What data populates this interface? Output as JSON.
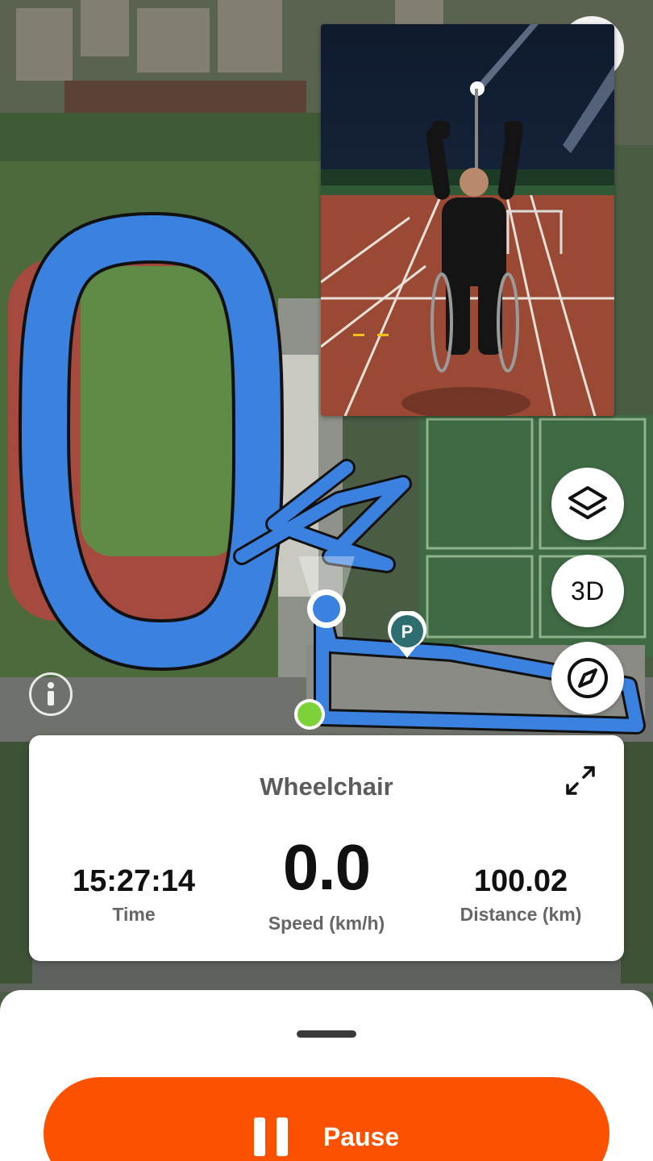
{
  "map": {
    "info_icon": "info-icon",
    "parking_label": "P"
  },
  "map_controls": {
    "layers_icon": "layers-icon",
    "three_d_label": "3D",
    "compass_icon": "compass-icon"
  },
  "photo": {
    "subject": "athlete-in-wheelchair-on-track-photo"
  },
  "stats": {
    "activity_type": "Wheelchair",
    "expand_icon": "expand-icon",
    "time_value": "15:27:14",
    "time_label": "Time",
    "speed_value": "0.0",
    "speed_label": "Speed (km/h)",
    "distance_value": "100.02",
    "distance_label": "Distance (km)"
  },
  "bottom_sheet": {
    "pause_label": "Pause",
    "pause_icon": "pause-icon"
  },
  "colors": {
    "accent": "#fc5200",
    "route": "#3b82e0",
    "start_point": "#7dd23a"
  }
}
